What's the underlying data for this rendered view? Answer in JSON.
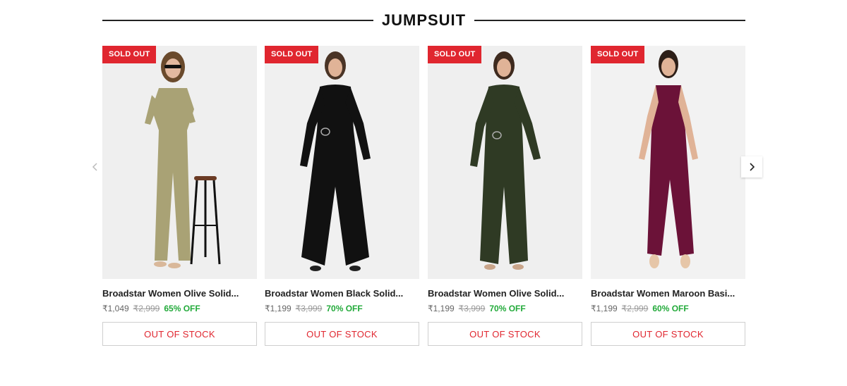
{
  "section": {
    "title": "JUMPSUIT"
  },
  "nav": {
    "prev_icon": "chevron-left-icon",
    "next_icon": "chevron-right-icon"
  },
  "colors": {
    "accent_red": "#e0262f",
    "discount_green": "#22aa3a"
  },
  "products": [
    {
      "badge": "SOLD OUT",
      "name": "Broadstar Women Olive Solid...",
      "price": "₹1,049",
      "mrp": "₹2,999",
      "discount": "65% OFF",
      "button": "OUT OF STOCK",
      "garment_color": "#a9a275",
      "image_icon": "product-image-olive-jumpsuit"
    },
    {
      "badge": "SOLD OUT",
      "name": "Broadstar Women Black Solid...",
      "price": "₹1,199",
      "mrp": "₹3,999",
      "discount": "70% OFF",
      "button": "OUT OF STOCK",
      "garment_color": "#111111",
      "image_icon": "product-image-black-jumpsuit"
    },
    {
      "badge": "SOLD OUT",
      "name": "Broadstar Women Olive Solid...",
      "price": "₹1,199",
      "mrp": "₹3,999",
      "discount": "70% OFF",
      "button": "OUT OF STOCK",
      "garment_color": "#2f3a24",
      "image_icon": "product-image-dark-olive-jumpsuit"
    },
    {
      "badge": "SOLD OUT",
      "name": "Broadstar Women Maroon Basi...",
      "price": "₹1,199",
      "mrp": "₹2,999",
      "discount": "60% OFF",
      "button": "OUT OF STOCK",
      "garment_color": "#6b1238",
      "image_icon": "product-image-maroon-jumpsuit"
    }
  ]
}
